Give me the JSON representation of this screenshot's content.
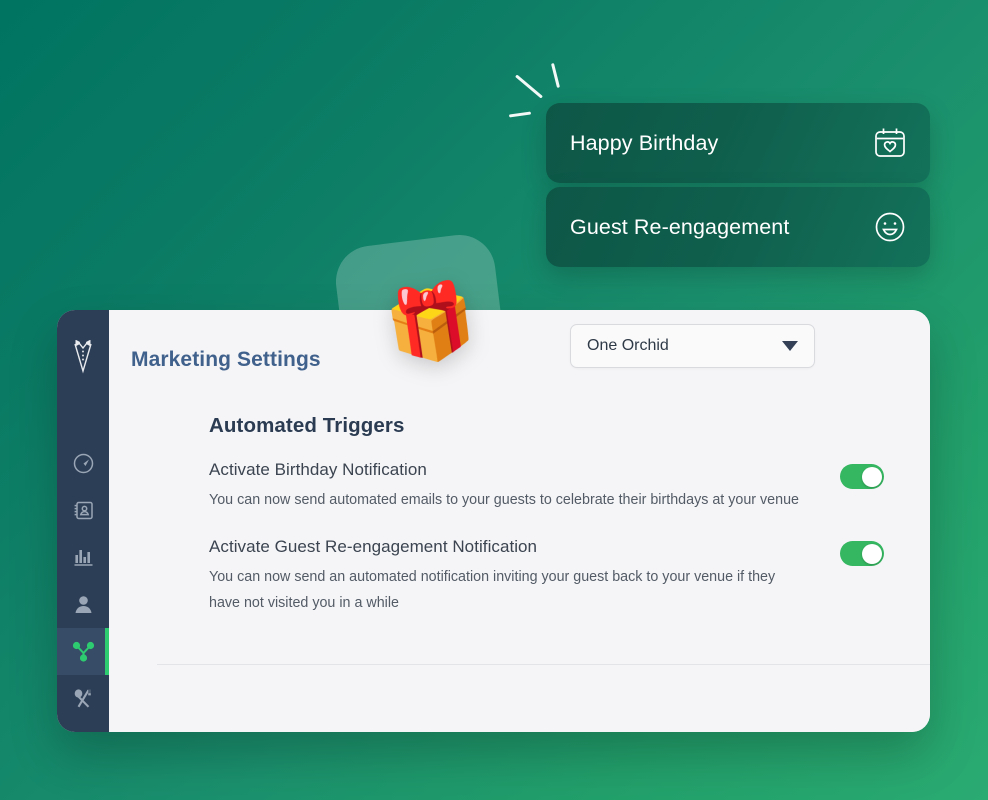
{
  "theme": {
    "background_start": "#007461",
    "background_end": "#2aab72",
    "accent_green": "#2ecc71",
    "toggle_on": "#35b660",
    "sidebar_bg": "#2c3e56",
    "card_bg": "#f5f5f7",
    "title_color": "#40618c",
    "section_title_color": "#2b3c52"
  },
  "chips": [
    {
      "label": "Happy Birthday",
      "icon": "calendar-heart-icon"
    },
    {
      "label": "Guest Re-engagement",
      "icon": "smiley-face-icon"
    }
  ],
  "decoration": {
    "gift_emoji": "🎁",
    "sparkle_count": 3
  },
  "sidebar": {
    "logo_icon": "bowtie-vest-logo-icon",
    "items": [
      {
        "icon": "compass-clock-icon",
        "active": false
      },
      {
        "icon": "contacts-book-icon",
        "active": false
      },
      {
        "icon": "bar-chart-icon",
        "active": false
      },
      {
        "icon": "person-icon",
        "active": false
      },
      {
        "icon": "marketing-nodes-icon",
        "active": true
      },
      {
        "icon": "fork-spoon-icon",
        "active": false
      }
    ]
  },
  "header": {
    "title": "Marketing Settings",
    "venue_select": {
      "value": "One Orchid",
      "caret_icon": "chevron-down-icon"
    }
  },
  "main": {
    "section_title": "Automated Triggers",
    "triggers": [
      {
        "title": "Activate Birthday Notification",
        "description": "You can now send automated emails to your guests to celebrate their birthdays at your venue",
        "enabled": true
      },
      {
        "title": "Activate Guest Re-engagement Notification",
        "description": "You can now send an automated notification inviting your guest back to your venue if they have not visited you in a while",
        "enabled": true
      }
    ]
  }
}
